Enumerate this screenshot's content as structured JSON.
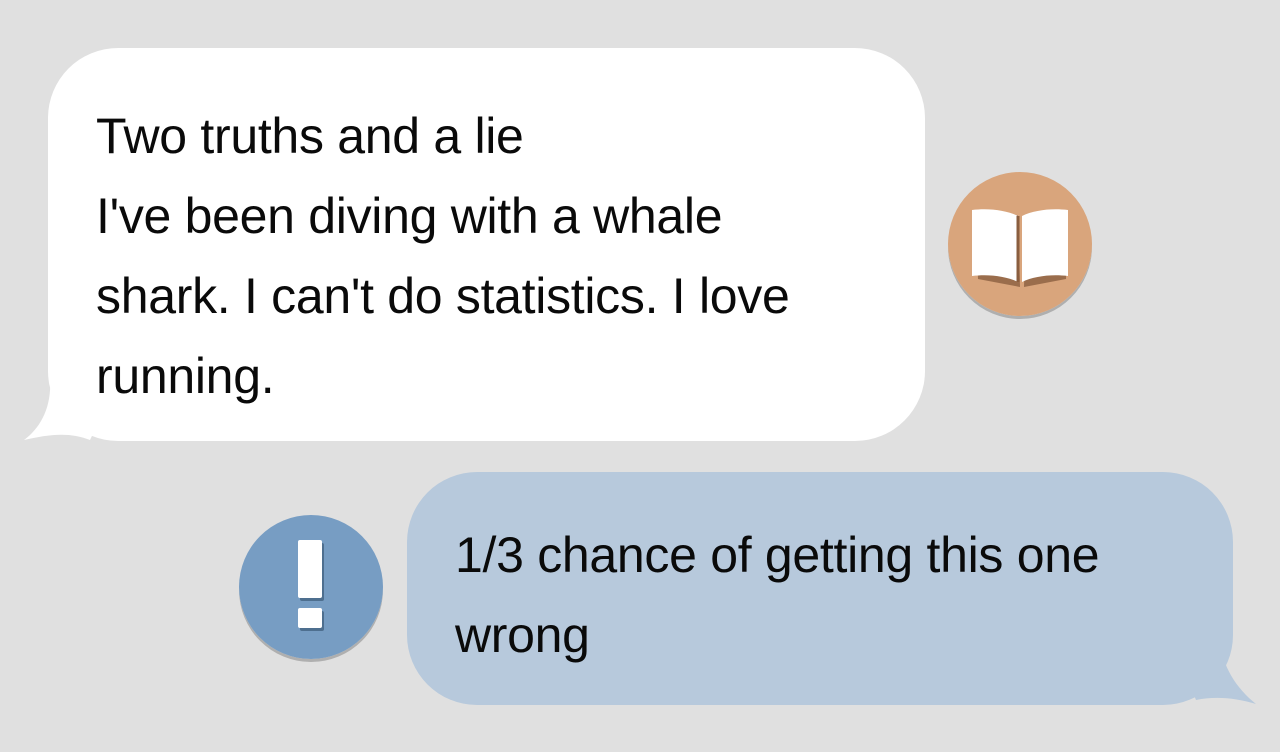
{
  "chat": {
    "messages": [
      {
        "sender": "book",
        "lines": [
          "Two truths and a lie",
          "I've been diving with a whale",
          "shark. I can't do statistics. I love",
          "running."
        ]
      },
      {
        "sender": "alert",
        "lines": [
          "1/3 chance of getting this one",
          "wrong"
        ]
      }
    ],
    "avatars": {
      "book": {
        "icon": "open-book-icon",
        "color": "#d9a57c"
      },
      "alert": {
        "icon": "exclamation-icon",
        "color": "#779dc3"
      }
    },
    "colors": {
      "background": "#e0e0e0",
      "incoming_bubble": "#ffffff",
      "outgoing_bubble": "#b7c9dc"
    }
  }
}
